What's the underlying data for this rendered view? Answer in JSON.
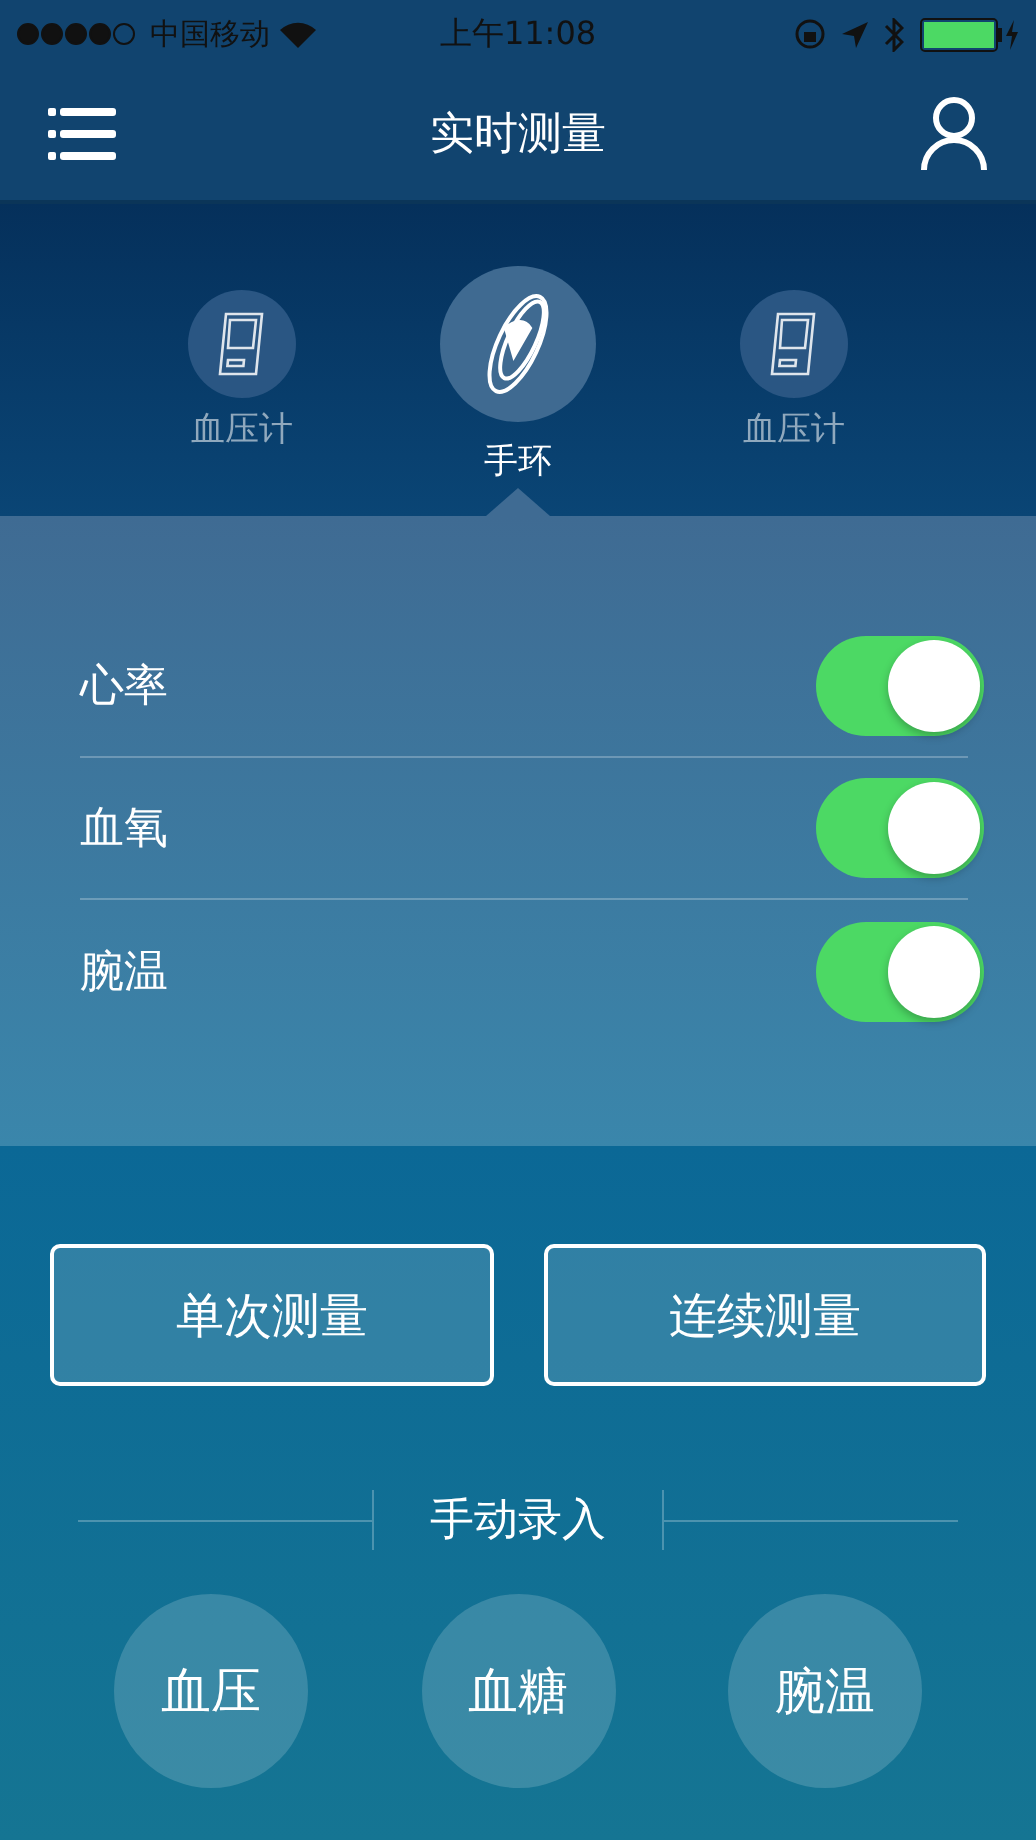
{
  "status_bar": {
    "signal_dots": [
      {
        "filled": true
      },
      {
        "filled": true
      },
      {
        "filled": true
      },
      {
        "filled": true
      },
      {
        "filled": false
      }
    ],
    "carrier": "中国移动",
    "time": "上午11:08",
    "battery": {
      "level": 1
    }
  },
  "nav": {
    "title": "实时测量"
  },
  "devices": [
    {
      "label": "血压计",
      "kind": "monitor",
      "selected": false
    },
    {
      "label": "手环",
      "kind": "band",
      "selected": true
    },
    {
      "label": "血压计",
      "kind": "monitor",
      "selected": false
    }
  ],
  "toggles": [
    {
      "label": "心率",
      "on": true
    },
    {
      "label": "血氧",
      "on": true
    },
    {
      "label": "腕温",
      "on": true
    }
  ],
  "buttons": [
    "单次测量",
    "连续测量"
  ],
  "manual": {
    "title": "手动录入",
    "items": [
      "血压",
      "血糖",
      "腕温"
    ]
  }
}
